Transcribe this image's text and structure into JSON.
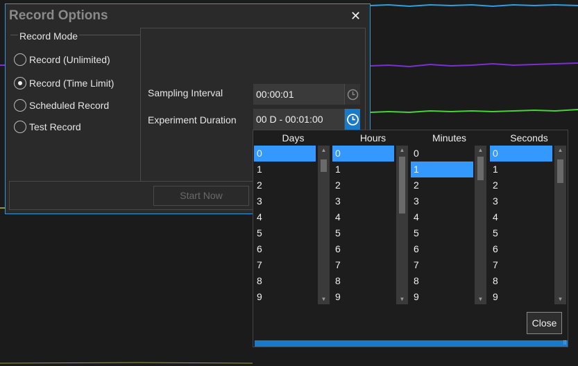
{
  "dialog": {
    "title": "Record Options",
    "close_glyph": "✕"
  },
  "record_mode": {
    "label": "Record Mode",
    "options": [
      {
        "label": "Record (Unlimited)",
        "selected": false
      },
      {
        "label": "Record (Time Limit)",
        "selected": true
      },
      {
        "label": "Scheduled Record",
        "selected": false
      },
      {
        "label": "Test Record",
        "selected": false
      }
    ]
  },
  "settings": {
    "sampling_interval_label": "Sampling Interval",
    "sampling_interval_value": "00:00:01",
    "experiment_duration_label": "Experiment Duration",
    "experiment_duration_value": "00 D - 00:01:00"
  },
  "start_now_label": "Start Now",
  "picker": {
    "columns": [
      {
        "header": "Days",
        "items": [
          "0",
          "1",
          "2",
          "3",
          "4",
          "5",
          "6",
          "7",
          "8",
          "9"
        ],
        "selected": "0"
      },
      {
        "header": "Hours",
        "items": [
          "0",
          "1",
          "2",
          "3",
          "4",
          "5",
          "6",
          "7",
          "8",
          "9"
        ],
        "selected": "0"
      },
      {
        "header": "Minutes",
        "items": [
          "0",
          "1",
          "2",
          "3",
          "4",
          "5",
          "6",
          "7",
          "8",
          "9"
        ],
        "selected": "1"
      },
      {
        "header": "Seconds",
        "items": [
          "0",
          "1",
          "2",
          "3",
          "4",
          "5",
          "6",
          "7",
          "8",
          "9"
        ],
        "selected": "0"
      }
    ],
    "close_label": "Close"
  },
  "colors": {
    "accent": "#1a7ac8",
    "selection": "#3399ff",
    "trace_blue": "#2e9fe0",
    "trace_purple": "#7b2fd6",
    "trace_green": "#49d33a",
    "trace_yellow": "#b9c531"
  }
}
